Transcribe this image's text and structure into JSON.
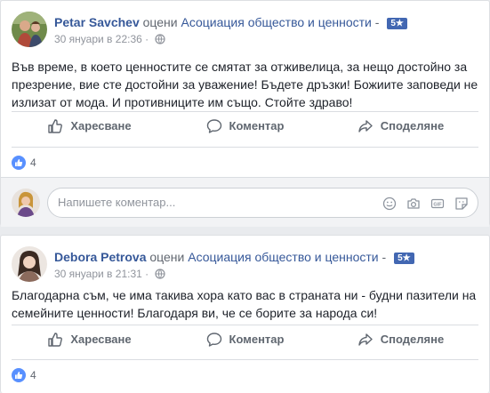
{
  "posts": [
    {
      "author": "Petar Savchev",
      "verb": " оцени ",
      "page": "Асоциация общество и ценности",
      "separator": " - ",
      "rating": "5★",
      "timestamp": "30 януари в 22:36",
      "meta_sep": " · ",
      "text": "Във време, в което ценностите се смятат за отживелица, за нещо достойно за презрение, вие сте достойни за уважение! Бъдете дръзки! Божиите заповеди не излизат от мода. И противниците им също. Стойте здраво!",
      "like_label": "Харесване",
      "comment_label": "Коментар",
      "share_label": "Споделяне",
      "reaction_count": "4"
    },
    {
      "author": "Debora Petrova",
      "verb": " оцени ",
      "page": "Асоциация общество и ценности",
      "separator": " - ",
      "rating": "5★",
      "timestamp": "30 януари в 21:31",
      "meta_sep": " · ",
      "text": "Благодарна съм, че има такива хора като вас в страната ни - будни пазители на семейните ценности! Благодаря ви, че се борите за народа си!",
      "like_label": "Харесване",
      "comment_label": "Коментар",
      "share_label": "Споделяне",
      "reaction_count": "4"
    }
  ],
  "comment_input": {
    "placeholder": "Напишете коментар..."
  },
  "comment_icons": [
    "emoji-icon",
    "camera-icon",
    "gif-icon",
    "sticker-icon"
  ],
  "colors": {
    "link": "#365899",
    "badge": "#4267b2",
    "like": "#5890ff",
    "muted": "#90949c"
  }
}
